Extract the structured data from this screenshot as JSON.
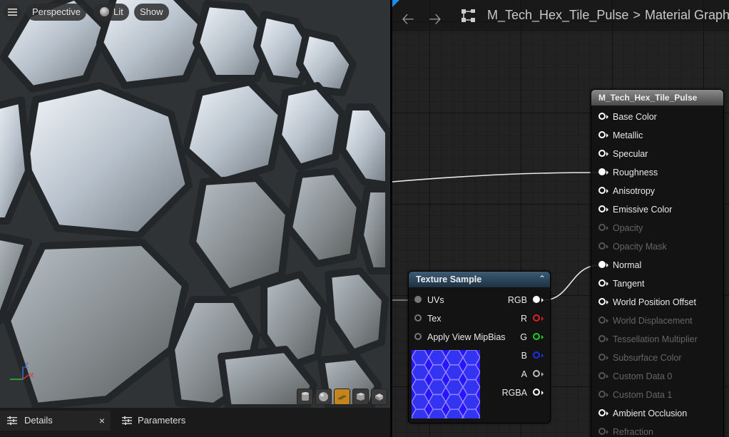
{
  "viewport": {
    "perspective_label": "Perspective",
    "lit_label": "Lit",
    "show_label": "Show",
    "axis": {
      "x": "X",
      "z": "Z"
    },
    "preview_shapes": [
      "cylinder-icon",
      "sphere-icon",
      "plane-icon",
      "cube-icon",
      "teapot-icon"
    ],
    "active_shape": "plane-icon"
  },
  "bottom_tabs": {
    "details_label": "Details",
    "close_glyph": "×",
    "parameters_label": "Parameters"
  },
  "graph": {
    "breadcrumb": {
      "material": "M_Tech_Hex_Tile_Pulse",
      "separator": ">",
      "graph": "Material Graph"
    }
  },
  "material_node": {
    "title": "M_Tech_Hex_Tile_Pulse",
    "inputs": [
      {
        "label": "Base Color",
        "enabled": true,
        "connected": false
      },
      {
        "label": "Metallic",
        "enabled": true,
        "connected": false
      },
      {
        "label": "Specular",
        "enabled": true,
        "connected": false
      },
      {
        "label": "Roughness",
        "enabled": true,
        "connected": true
      },
      {
        "label": "Anisotropy",
        "enabled": true,
        "connected": false
      },
      {
        "label": "Emissive Color",
        "enabled": true,
        "connected": false
      },
      {
        "label": "Opacity",
        "enabled": false,
        "connected": false
      },
      {
        "label": "Opacity Mask",
        "enabled": false,
        "connected": false
      },
      {
        "label": "Normal",
        "enabled": true,
        "connected": true
      },
      {
        "label": "Tangent",
        "enabled": true,
        "connected": false
      },
      {
        "label": "World Position Offset",
        "enabled": true,
        "connected": false
      },
      {
        "label": "World Displacement",
        "enabled": false,
        "connected": false
      },
      {
        "label": "Tessellation Multiplier",
        "enabled": false,
        "connected": false
      },
      {
        "label": "Subsurface Color",
        "enabled": false,
        "connected": false
      },
      {
        "label": "Custom Data 0",
        "enabled": false,
        "connected": false
      },
      {
        "label": "Custom Data 1",
        "enabled": false,
        "connected": false
      },
      {
        "label": "Ambient Occlusion",
        "enabled": true,
        "connected": false
      },
      {
        "label": "Refraction",
        "enabled": false,
        "connected": false
      }
    ]
  },
  "texture_node": {
    "title": "Texture Sample",
    "inputs": [
      {
        "label": "UVs",
        "connected": true
      },
      {
        "label": "Tex",
        "connected": false
      },
      {
        "label": "Apply View MipBias",
        "connected": false
      }
    ],
    "outputs": [
      {
        "label": "RGB",
        "color": "#ffffff",
        "connected": true
      },
      {
        "label": "R",
        "color": "#e02020",
        "connected": false
      },
      {
        "label": "G",
        "color": "#20d020",
        "connected": false
      },
      {
        "label": "B",
        "color": "#2030e0",
        "connected": false
      },
      {
        "label": "A",
        "color": "#bbbbbb",
        "connected": false
      },
      {
        "label": "RGBA",
        "color": "#ffffff",
        "connected": false
      }
    ]
  },
  "colors": {
    "accent": "#1d8fe8",
    "active_shape": "#c4861c",
    "texture_header": "#2b4a62",
    "material_header": "#6e6e6e"
  }
}
